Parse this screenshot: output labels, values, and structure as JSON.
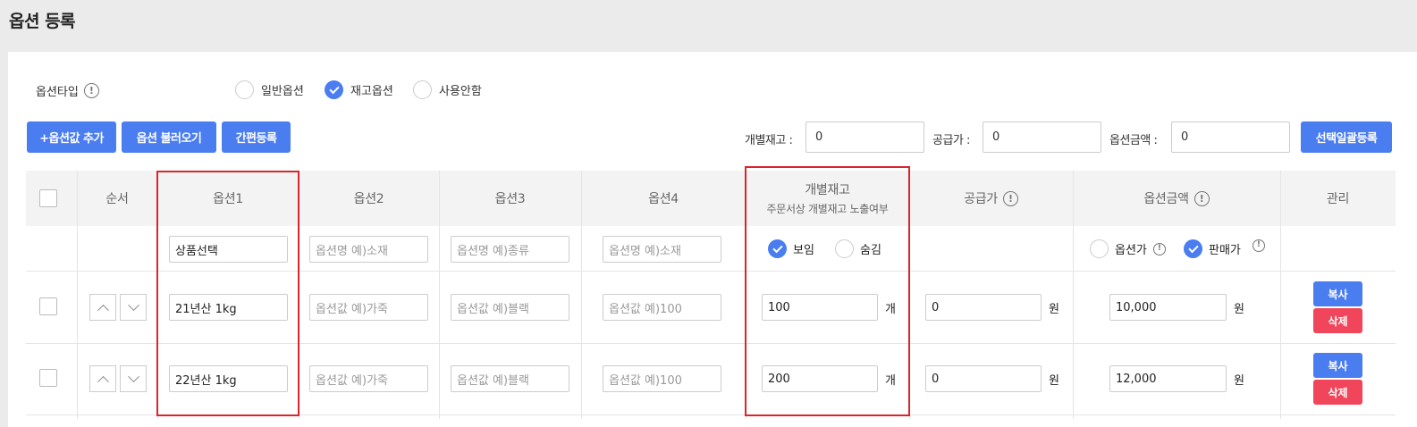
{
  "page": {
    "title": "옵션 등록"
  },
  "option_type": {
    "label": "옵션타입",
    "options": [
      {
        "label": "일반옵션",
        "checked": false
      },
      {
        "label": "재고옵션",
        "checked": true
      },
      {
        "label": "사용안함",
        "checked": false
      }
    ]
  },
  "toolbar": {
    "add_value": "+옵션값 추가",
    "load_options": "옵션 불러오기",
    "quick_register": "간편등록",
    "stock_label": "개별재고 :",
    "stock_value": "0",
    "supply_label": "공급가 :",
    "supply_value": "0",
    "price_label": "옵션금액 :",
    "price_value": "0",
    "bulk_apply": "선택일괄등록"
  },
  "table": {
    "headers": {
      "order": "순서",
      "opt1": "옵션1",
      "opt2": "옵션2",
      "opt3": "옵션3",
      "opt4": "옵션4",
      "stock": "개별재고",
      "stock_sub": "주문서상 개별재고 노출여부",
      "supply": "공급가",
      "price": "옵션금액",
      "manage": "관리"
    },
    "name_row": {
      "opt1": "상품선택",
      "opt2_placeholder": "옵션명 예)소재",
      "opt3_placeholder": "옵션명 예)종류",
      "opt4_placeholder": "옵션명 예)소재",
      "show_label": "보임",
      "hide_label": "숨김",
      "option_price_label": "옵션가",
      "sale_price_label": "판매가"
    },
    "rows": [
      {
        "opt1": "21년산 1kg",
        "opt2_placeholder": "옵션값 예)가죽",
        "opt3_placeholder": "옵션값 예)블랙",
        "opt4_placeholder": "옵션값 예)100",
        "stock": "100",
        "stock_unit": "개",
        "supply": "0",
        "supply_unit": "원",
        "price": "10,000",
        "price_unit": "원",
        "copy": "복사",
        "delete": "삭제"
      },
      {
        "opt1": "22년산 1kg",
        "opt2_placeholder": "옵션값 예)가죽",
        "opt3_placeholder": "옵션값 예)블랙",
        "opt4_placeholder": "옵션값 예)100",
        "stock": "200",
        "stock_unit": "개",
        "supply": "0",
        "supply_unit": "원",
        "price": "12,000",
        "price_unit": "원",
        "copy": "복사",
        "delete": "삭제"
      }
    ]
  },
  "icons": {
    "info": "info-icon",
    "check": "check-icon",
    "up": "chevron-up-icon",
    "down": "chevron-down-icon"
  },
  "colors": {
    "primary": "#4a7df0",
    "danger": "#f0455a",
    "highlight": "#d9252b"
  }
}
